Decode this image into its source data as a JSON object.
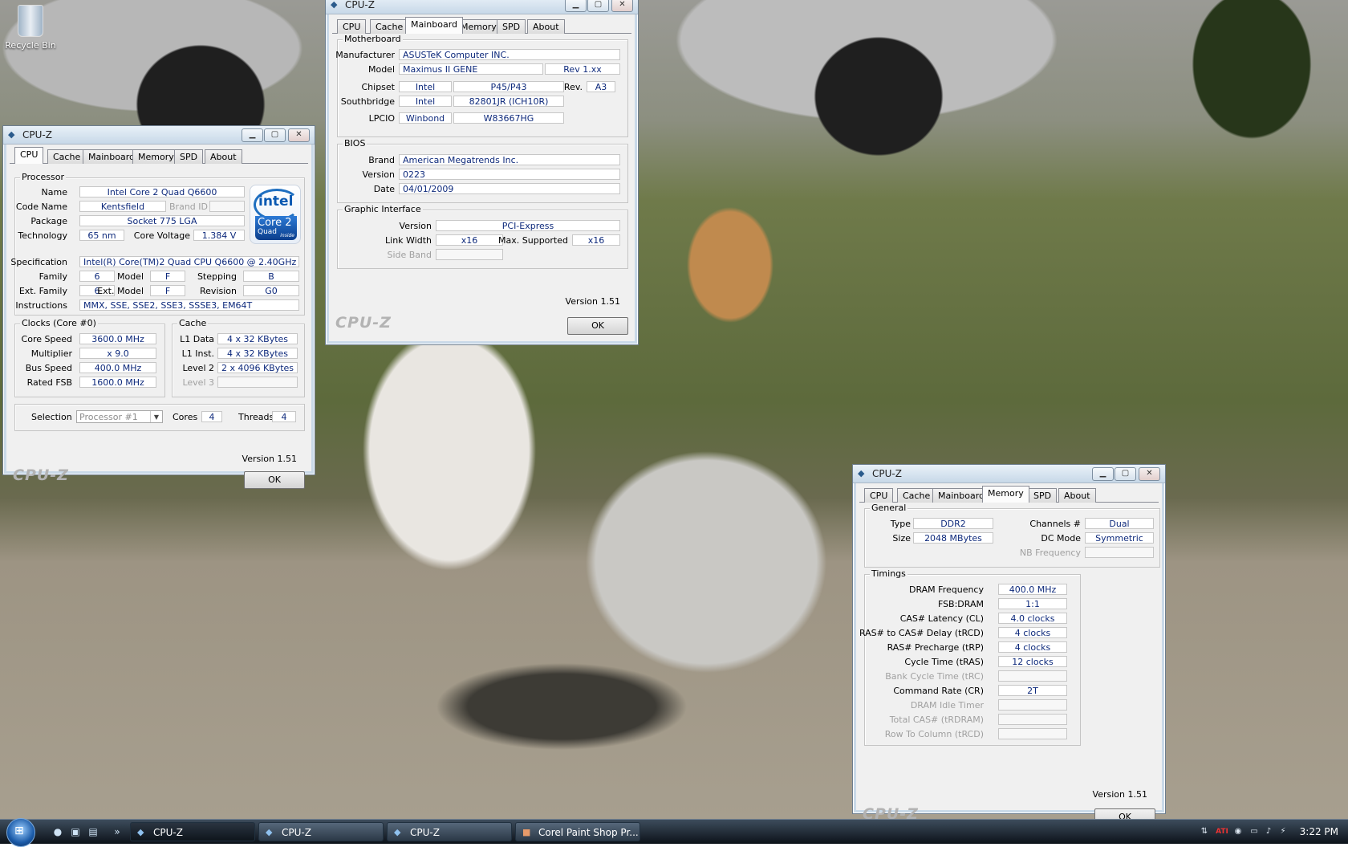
{
  "desktop": {
    "recycle_bin_label": "Recycle Bin"
  },
  "app_title": "CPU-Z",
  "tabs": [
    "CPU",
    "Cache",
    "Mainboard",
    "Memory",
    "SPD",
    "About"
  ],
  "window_cpu": {
    "processor_group": "Processor",
    "name_label": "Name",
    "name": "Intel Core 2 Quad Q6600",
    "code_name_label": "Code Name",
    "code_name": "Kentsfield",
    "brand_id_label": "Brand ID",
    "package_label": "Package",
    "package": "Socket 775 LGA",
    "technology_label": "Technology",
    "technology": "65 nm",
    "core_voltage_label": "Core Voltage",
    "core_voltage": "1.384 V",
    "specification_label": "Specification",
    "specification": "Intel(R) Core(TM)2 Quad CPU    Q6600  @ 2.40GHz",
    "family_label": "Family",
    "family": "6",
    "model_label": "Model",
    "model": "F",
    "stepping_label": "Stepping",
    "stepping": "B",
    "ext_family_label": "Ext. Family",
    "ext_family": "6",
    "ext_model_label": "Ext. Model",
    "ext_model": "F",
    "revision_label": "Revision",
    "revision": "G0",
    "instructions_label": "Instructions",
    "instructions": "MMX, SSE, SSE2, SSE3, SSSE3, EM64T",
    "intel_logo": {
      "brand": "intel",
      "line1": "Core 2",
      "line2": "Quad",
      "line3": "inside"
    },
    "clocks_group": "Clocks (Core #0)",
    "core_speed_label": "Core Speed",
    "core_speed": "3600.0 MHz",
    "multiplier_label": "Multiplier",
    "multiplier": "x 9.0",
    "bus_speed_label": "Bus Speed",
    "bus_speed": "400.0 MHz",
    "rated_fsb_label": "Rated FSB",
    "rated_fsb": "1600.0 MHz",
    "cache_group": "Cache",
    "l1_data_label": "L1 Data",
    "l1_data": "4 x 32 KBytes",
    "l1_inst_label": "L1 Inst.",
    "l1_inst": "4 x 32 KBytes",
    "level2_label": "Level 2",
    "level2": "2 x 4096 KBytes",
    "level3_label": "Level 3",
    "selection_label": "Selection",
    "selection_value": "Processor #1",
    "cores_label": "Cores",
    "cores": "4",
    "threads_label": "Threads",
    "threads": "4",
    "version": "Version 1.51",
    "logo": "CPU-Z",
    "ok": "OK"
  },
  "window_mainboard": {
    "motherboard_group": "Motherboard",
    "manufacturer_label": "Manufacturer",
    "manufacturer": "ASUSTeK Computer INC.",
    "model_label": "Model",
    "model": "Maximus II GENE",
    "model_rev": "Rev 1.xx",
    "chipset_label": "Chipset",
    "chipset_vendor": "Intel",
    "chipset_name": "P45/P43",
    "rev_label": "Rev.",
    "rev": "A3",
    "southbridge_label": "Southbridge",
    "southbridge_vendor": "Intel",
    "southbridge_name": "82801JR (ICH10R)",
    "lpcio_label": "LPCIO",
    "lpcio_vendor": "Winbond",
    "lpcio_name": "W83667HG",
    "bios_group": "BIOS",
    "brand_label": "Brand",
    "brand": "American Megatrends Inc.",
    "version_label": "Version",
    "bios_version": "0223",
    "date_label": "Date",
    "date": "04/01/2009",
    "graphic_group": "Graphic Interface",
    "gi_version_label": "Version",
    "gi_version": "PCI-Express",
    "link_width_label": "Link Width",
    "link_width": "x16",
    "max_supported_label": "Max. Supported",
    "max_supported": "x16",
    "side_band_label": "Side Band",
    "version": "Version 1.51",
    "logo": "CPU-Z",
    "ok": "OK"
  },
  "window_memory": {
    "general_group": "General",
    "type_label": "Type",
    "type": "DDR2",
    "size_label": "Size",
    "size": "2048 MBytes",
    "channels_label": "Channels #",
    "channels": "Dual",
    "dc_mode_label": "DC Mode",
    "dc_mode": "Symmetric",
    "nb_freq_label": "NB Frequency",
    "timings_group": "Timings",
    "dram_freq_label": "DRAM Frequency",
    "dram_freq": "400.0 MHz",
    "fsb_dram_label": "FSB:DRAM",
    "fsb_dram": "1:1",
    "cas_label": "CAS# Latency (CL)",
    "cas": "4.0 clocks",
    "trcd_label": "RAS# to CAS# Delay (tRCD)",
    "trcd": "4 clocks",
    "trp_label": "RAS# Precharge (tRP)",
    "trp": "4 clocks",
    "tras_label": "Cycle Time (tRAS)",
    "tras": "12 clocks",
    "trc_label": "Bank Cycle Time (tRC)",
    "cr_label": "Command Rate (CR)",
    "cr": "2T",
    "idle_label": "DRAM Idle Timer",
    "total_cas_label": "Total CAS# (tRDRAM)",
    "row_col_label": "Row To Column (tRCD)",
    "version": "Version 1.51",
    "logo": "CPU-Z",
    "ok": "OK"
  },
  "taskbar": {
    "tasks": [
      "CPU-Z",
      "CPU-Z",
      "CPU-Z",
      "Corel Paint Shop Pr..."
    ],
    "clock": "3:22 PM",
    "tray_brand": "ATI"
  }
}
